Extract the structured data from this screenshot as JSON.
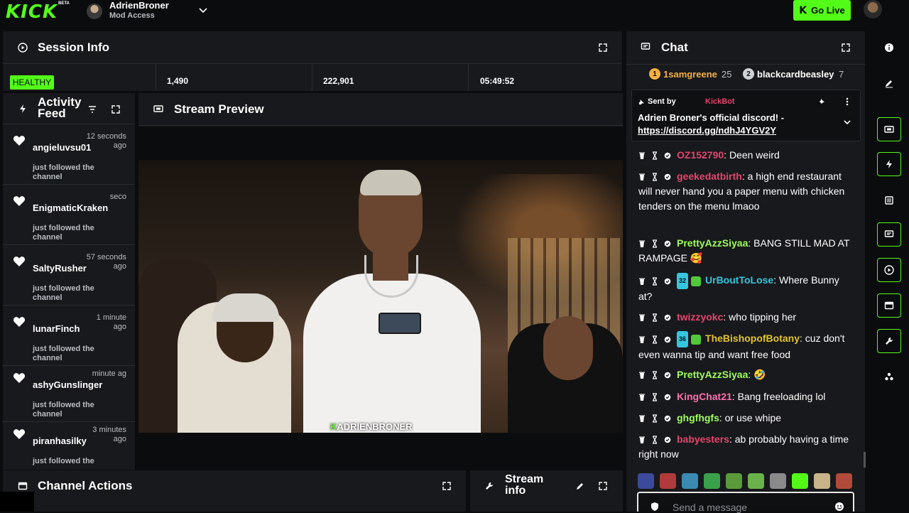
{
  "topbar": {
    "logo": "KICK",
    "beta": "BETA",
    "channel_name": "AdrienBroner",
    "channel_sub": "Mod Access",
    "go_live_label": "Go Live"
  },
  "session": {
    "title": "Session Info",
    "health": "HEALTHY",
    "stats": [
      "1,490",
      "222,901",
      "05:49:52"
    ]
  },
  "activity": {
    "title_line1": "Activity",
    "title_line2": "Feed",
    "items": [
      {
        "user": "angieluvsu01",
        "time": "12 seconds ago",
        "desc": "just followed the channel"
      },
      {
        "user": "EnigmaticKraken",
        "time": "seco",
        "desc": "just followed the channel"
      },
      {
        "user": "SaltyRusher",
        "time": "57 seconds ago",
        "desc": "just followed the channel"
      },
      {
        "user": "lunarFinch",
        "time": "1 minute ago",
        "desc": "just followed the channel"
      },
      {
        "user": "ashyGunslinger",
        "time": "minute ag",
        "desc": "just followed the channel"
      },
      {
        "user": "piranhasilky",
        "time": "3 minutes ago",
        "desc": "just followed the"
      }
    ]
  },
  "preview": {
    "title": "Stream Preview",
    "watermark_k": "K",
    "watermark_text": "ADRIENBRONER"
  },
  "bottom": {
    "channel_actions": "Channel Actions",
    "stream_info_line1": "Stream",
    "stream_info_line2": "info"
  },
  "chat": {
    "title": "Chat",
    "leaders": [
      {
        "rank": "1",
        "name": "1samgreene",
        "count": "25",
        "color": "#f5b041"
      },
      {
        "rank": "2",
        "name": "blackcardbeasley",
        "count": "7",
        "color": "#cfd3d8"
      }
    ],
    "pinned": {
      "sent_by": "Sent by",
      "sender": "KickBot",
      "text": "Adrien Broner's official discord! -",
      "link": "https://discord.gg/ndhJ4YGV2Y"
    },
    "messages": [
      {
        "user": "OZ152790",
        "color": "#e5446d",
        "text": ": Deen weird"
      },
      {
        "user": "geekedatbirth",
        "color": "#e5446d",
        "text": ": a high end restaurant will never hand you a paper menu with chicken tenders on the menu lmaoo"
      },
      {
        "user": "PrettyAzzSiyaa",
        "color": "#9dff5a",
        "text": ": BANG STILL MAD AT RAMPAGE 🥰"
      },
      {
        "user": "UrBoutToLose",
        "color": "#34c6e0",
        "text": ": Where Bunny at?",
        "badge": "32"
      },
      {
        "user": "twizzyokc",
        "color": "#e5446d",
        "text": ": who tipping her"
      },
      {
        "user": "TheBishopofBotany",
        "color": "#e3c432",
        "text": ": cuz don't even wanna tip and want free food",
        "badge": "36"
      },
      {
        "user": "PrettyAzzSiyaa",
        "color": "#9dff5a",
        "text": ": 🤣"
      },
      {
        "user": "KingChat21",
        "color": "#ff6fae",
        "text": ": Bang freeloading lol"
      },
      {
        "user": "ghgfhgfs",
        "color": "#9dff5a",
        "text": ": or use whipe"
      },
      {
        "user": "babyesters",
        "color": "#e5446d",
        "text": ": ab probably having a time right now"
      }
    ],
    "send_placeholder": "Send a message"
  },
  "colors": {
    "accent": "#53fc18",
    "panel": "#18191c",
    "background": "#0b0c0e"
  }
}
